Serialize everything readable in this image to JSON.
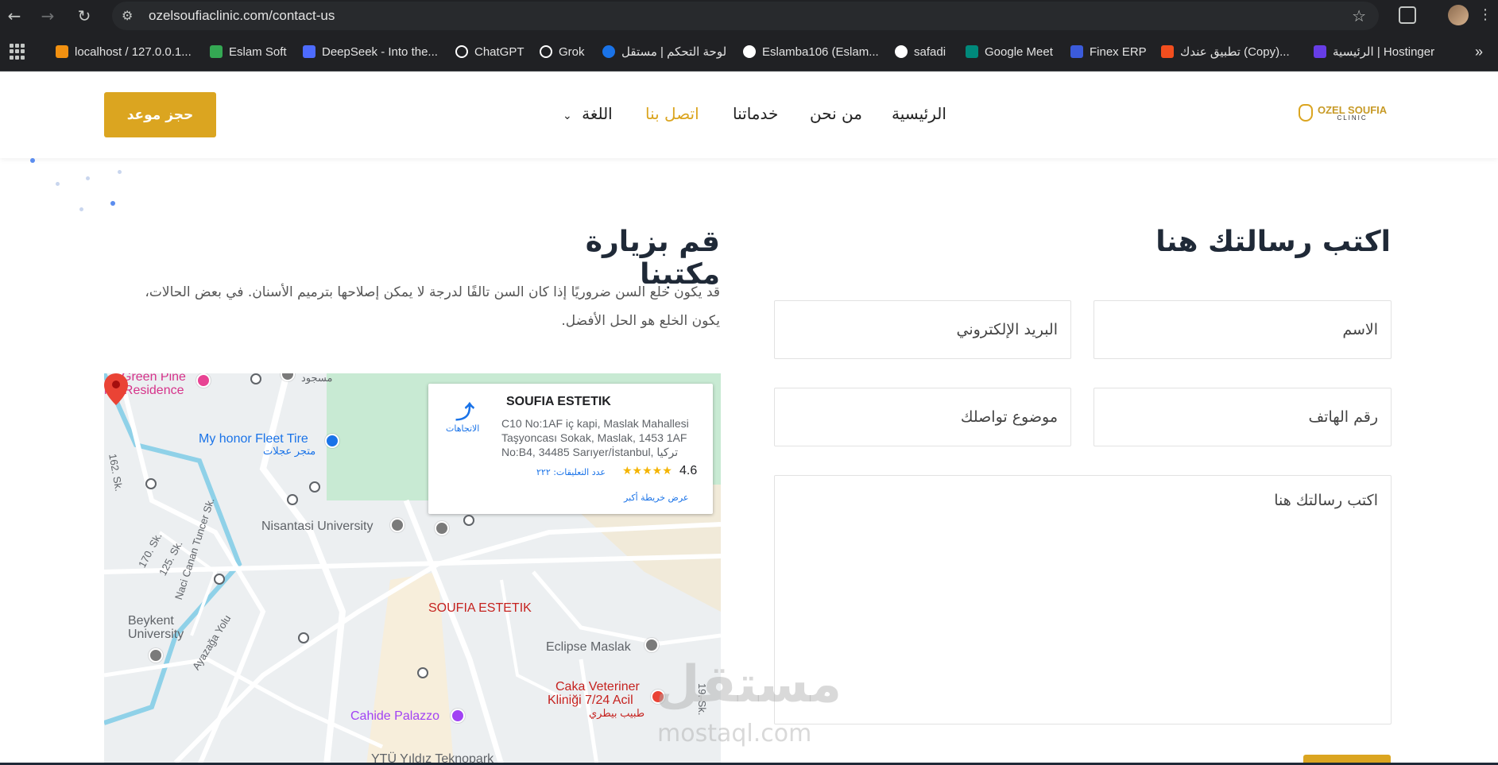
{
  "browser": {
    "url": "ozelsoufiaclinic.com/contact-us",
    "bookmarks": [
      {
        "label": "localhost / 127.0.0.1...",
        "color": "#f29111"
      },
      {
        "label": "Eslam Soft",
        "color": "#34a853"
      },
      {
        "label": "DeepSeek - Into the...",
        "color": "#4d6bfe"
      },
      {
        "label": "ChatGPT",
        "color": "#ffffff"
      },
      {
        "label": "Grok",
        "color": "#ffffff"
      },
      {
        "label": "لوحة التحكم | مستقل",
        "color": "#1a73e8"
      },
      {
        "label": "Eslamba106 (Eslam...",
        "color": "#ffffff"
      },
      {
        "label": "safadi",
        "color": "#ffffff"
      },
      {
        "label": "Google Meet",
        "color": "#00897b"
      },
      {
        "label": "Finex ERP",
        "color": "#3b5bdb"
      },
      {
        "label": "تطبيق عندك (Copy)...",
        "color": "#f24e1e"
      },
      {
        "label": "الرئيسية | Hostinger",
        "color": "#673de6"
      }
    ]
  },
  "header": {
    "book_button": "حجز موعد",
    "nav": {
      "home": "الرئيسية",
      "about": "من نحن",
      "services": "خدماتنا",
      "contact": "اتصل بنا",
      "language": "اللغة"
    },
    "logo_line1": "OZEL SOUFIA",
    "logo_line2": "CLINIC",
    "accent_color": "#dba520"
  },
  "visit": {
    "title": "قم بزيارة مكتبنا",
    "description": "قد يكون خلع السن ضروريًا إذا كان السن تالفًا لدرجة لا يمكن إصلاحها بترميم الأسنان. في بعض الحالات، يكون الخلع هو الحل الأفضل."
  },
  "map": {
    "card": {
      "name": "SOUFIA ESTETIK",
      "address": "C10 No:1AF iç kapi, Maslak Mahallesi Taşyoncası Sokak, Maslak, 1453 1AF No:B4, 34485 Sarıyer/İstanbul, تركيا",
      "rating": "4.6",
      "stars": "★★★★★",
      "reviews": "عدد التعليقات: ٢٢٢",
      "larger_map": "عرض خريطة أكبر",
      "directions": "الاتجاهات"
    },
    "labels": {
      "green_pine": "Green Pine",
      "residence": "lak Residence",
      "fleet_tire": "My honor Fleet Tire",
      "fleet_tire_ar": "متجر عجلات",
      "nisantasi": "Nisantasi University",
      "soufia": "SOUFIA ESTETIK",
      "eclipse": "Eclipse Maslak",
      "caka": "Caka Veteriner",
      "caka2": "Kliniği 7/24 Acil",
      "caka_ar": "طبيب بيطري",
      "cahide": "Cahide Palazzo",
      "ytu": "YTÜ Yıldız Teknopark",
      "beykent": "Beykent",
      "university": "University",
      "street_162": "162. Sk.",
      "street_170": "170. Sk.",
      "street_125": "125. Sk.",
      "naci": "Naci Canan Tuncer Sk.",
      "ayazaga": "Ayazağa Yolu",
      "street_19": "19. Sk.",
      "mosque": "مسجود"
    }
  },
  "form": {
    "title": "اكتب رسالتك هنا",
    "name_placeholder": "الاسم",
    "email_placeholder": "البريد الإلكتروني",
    "phone_placeholder": "رقم الهاتف",
    "subject_placeholder": "موضوع تواصلك",
    "message_placeholder": "اكتب رسالتك هنا"
  },
  "watermark": {
    "ar": "مستقل",
    "en": "mostaql.com"
  }
}
